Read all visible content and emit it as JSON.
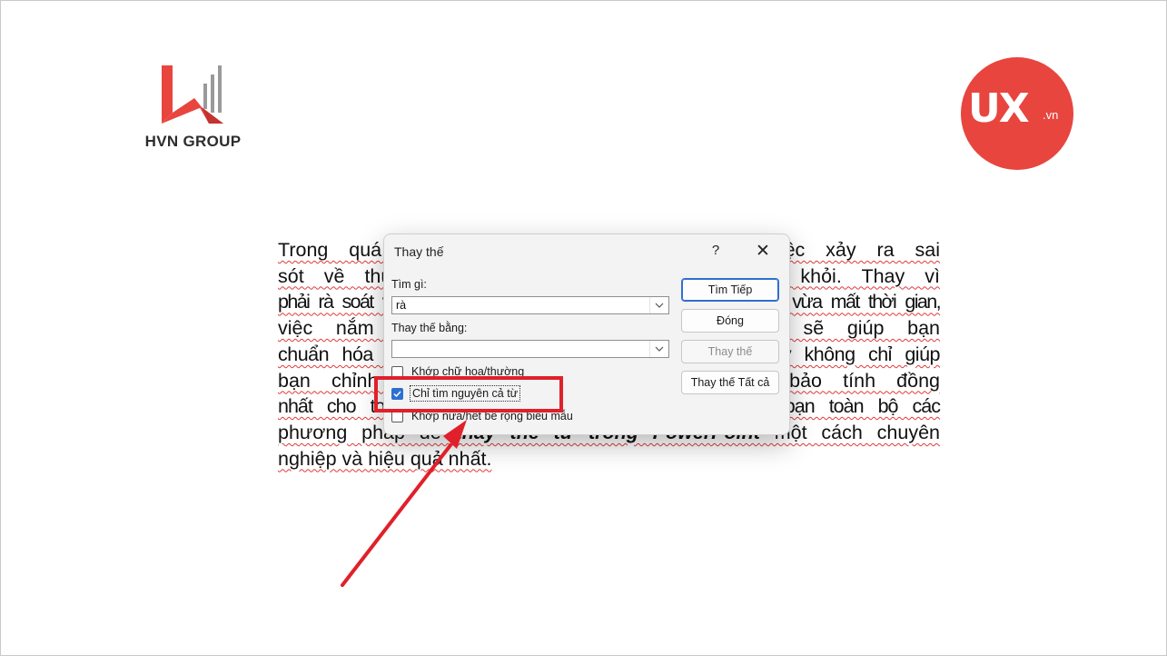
{
  "logos": {
    "left_brand": "HVN GROUP",
    "right_brand_main": "UX",
    "right_brand_suffix": ".vn"
  },
  "document": {
    "lines": [
      "Trong quá trình soạn thảo bài thuyết trình, việc xảy ra sai",
      "sót về thuật ngữ, chính tả là điều khó tránh khỏi. Thay vì",
      "phải rà soát và sửa từng từ một cách thủ công vừa tốn công vừa mất thời gian,",
      "việc nắm vững cách thay thế từ hàng loạt sẽ giúp bạn",
      "chuẩn hóa nội dung một cách nhanh chóng. Điều này không chỉ giúp",
      "bạn chỉnh sửa chính xác hơn mà còn đảm bảo tính đồng",
      "nhất cho toàn bài. Bài viết dưới đây sẽ hướng dẫn bạn toàn bộ các",
      "phương pháp để thay thế từ trong PowerPoint một cách chuyên",
      "nghiệp và hiệu quả nhất."
    ],
    "emphasis": "thay thế từ trong PowerPoint"
  },
  "dialog": {
    "title": "Thay thế",
    "help_label": "?",
    "close_label": "✕",
    "find_label": "Tìm gì:",
    "find_value": "rà",
    "replace_label": "Thay thế bằng:",
    "replace_value": "",
    "options": [
      {
        "label": "Khớp chữ hoa/thường",
        "checked": false
      },
      {
        "label": "Chỉ tìm nguyên cả từ",
        "checked": true
      },
      {
        "label": "Khớp nửa/hết bề rộng biểu mẫu",
        "checked": false
      }
    ],
    "buttons": {
      "find_next": "Tìm Tiếp",
      "close": "Đóng",
      "replace": "Thay thế",
      "replace_all": "Thay thế Tất cả"
    }
  },
  "annotation": {
    "highlight_color": "#e0202a"
  }
}
